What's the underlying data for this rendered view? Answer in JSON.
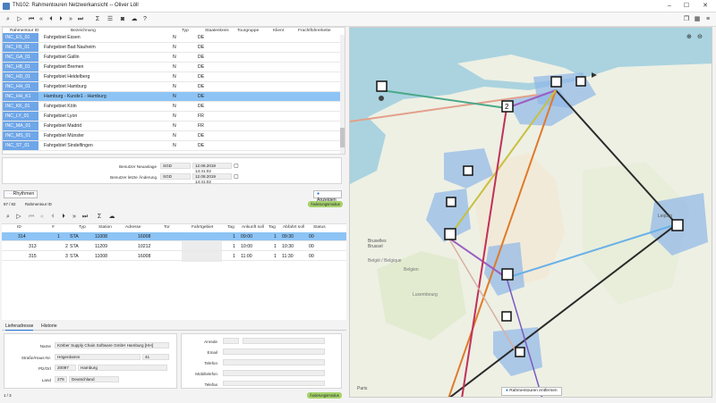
{
  "window": {
    "title": "TN102: Rahmentouren Netzwerkansicht -- Oliver Löll"
  },
  "top_table": {
    "headers": [
      "Rahmentour ID",
      "Bezeichnung",
      "Typ",
      "Staatenkreis",
      "Tourgruppe",
      "Klient",
      "Frachtführerkette"
    ],
    "rows": [
      {
        "id": "INC_ES_01",
        "name": "Fahrgebiet Essen",
        "typ": "N",
        "staat": "DE",
        "sel": false
      },
      {
        "id": "INC_FB_01",
        "name": "Fahrgebiet Bad Nauheim",
        "typ": "N",
        "staat": "DE",
        "sel": false
      },
      {
        "id": "INC_GA_01",
        "name": "Fahrgebiet Gallin",
        "typ": "N",
        "staat": "DE",
        "sel": false
      },
      {
        "id": "INC_HB_01",
        "name": "Fahrgebiet Bremen",
        "typ": "N",
        "staat": "DE",
        "sel": false
      },
      {
        "id": "INC_HD_01",
        "name": "Fahrgebiet Heidelberg",
        "typ": "N",
        "staat": "DE",
        "sel": false
      },
      {
        "id": "INC_HH_01",
        "name": "Fahrgebiet Hamburg",
        "typ": "N",
        "staat": "DE",
        "sel": false
      },
      {
        "id": "INC_HH_K1",
        "name": "Hamburg - Kunde1 - Hamburg",
        "typ": "N",
        "staat": "DE",
        "sel": true
      },
      {
        "id": "INC_KK_01",
        "name": "Fahrgebiet Köln",
        "typ": "N",
        "staat": "DE",
        "sel": false
      },
      {
        "id": "INC_LY_01",
        "name": "Fahrgebiet Lyon",
        "typ": "N",
        "staat": "FR",
        "sel": false
      },
      {
        "id": "INC_MA_01",
        "name": "Fahrgebiet Madrid",
        "typ": "N",
        "staat": "FR",
        "sel": false
      },
      {
        "id": "INC_MS_01",
        "name": "Fahrgebiet Münster",
        "typ": "N",
        "staat": "DE",
        "sel": false
      },
      {
        "id": "INC_ST_01",
        "name": "Fahrgebiet Sindelfingen",
        "typ": "N",
        "staat": "DE",
        "sel": false
      }
    ]
  },
  "audit": {
    "created_label": "Benutzer Neuanlage",
    "created_user": "SGD",
    "created_date": "12.08.2019 14:41:02",
    "changed_label": "Benutzer letzte Änderung",
    "changed_user": "SGD",
    "changed_date": "12.08.2019 14:41:02"
  },
  "rhythm_button": "Rhythmen",
  "show_button": "Anzeigen",
  "paging_top": "97 / 82",
  "paging_top_label": "Rahmentour ID",
  "changelog_badge": "Änderungsmodus",
  "bottom_table": {
    "headers": [
      "ID",
      "#",
      "Typ",
      "Station",
      "Adresse",
      "Tor",
      "Fahrtgebiet",
      "Tag",
      "Ankunft soll",
      "Tag",
      "Abfahrt soll",
      "Status"
    ],
    "rows": [
      {
        "id": "314",
        "n": "1",
        "typ": "STA",
        "station": "11008",
        "adresse": "16008",
        "tor": "",
        "tag1": "1",
        "ank": "09:00",
        "tag2": "1",
        "abf": "09:30",
        "status": "00",
        "sel": true
      },
      {
        "id": "313",
        "n": "2",
        "typ": "STA",
        "station": "11209",
        "adresse": "10212",
        "tor": "",
        "tag1": "1",
        "ank": "10:00",
        "tag2": "1",
        "abf": "10:30",
        "status": "00",
        "sel": false
      },
      {
        "id": "315",
        "n": "3",
        "typ": "STA",
        "station": "11008",
        "adresse": "16008",
        "tor": "",
        "tag1": "1",
        "ank": "11:00",
        "tag2": "1",
        "abf": "11:30",
        "status": "00",
        "sel": false
      }
    ]
  },
  "tabs": [
    "Lieferadresse",
    "Historie"
  ],
  "address": {
    "name_label": "Name",
    "name": "Körber Supply Chain Software GmbH Hamburg [HH]",
    "street_label": "Straße/Haus-Nr.",
    "street": "Högerdamm",
    "house": "41",
    "zip_label": "Plz/Ort",
    "zip": "20097",
    "city": "Hamburg",
    "country_label": "Land",
    "country_code": "276",
    "country": "Deutschland"
  },
  "contact": {
    "anrede": "Anrede",
    "email": "Email",
    "telefon": "Telefon",
    "mobil": "Mobiltelefon",
    "telefax": "Telefax"
  },
  "paging_bottom": "1 / 3",
  "map": {
    "remove_button": "Rahmentouren entfernen",
    "labels": [
      "Bruxelles",
      "Brussel",
      "België / Belgique",
      "Belgien",
      "Luxembourg",
      "Leipzig",
      "Paris"
    ]
  },
  "colors": {
    "selected_row": "#8dc4f5",
    "id_cell": "#6ea6e8",
    "badge": "#a7d36a",
    "accent": "#1f6fd6"
  }
}
